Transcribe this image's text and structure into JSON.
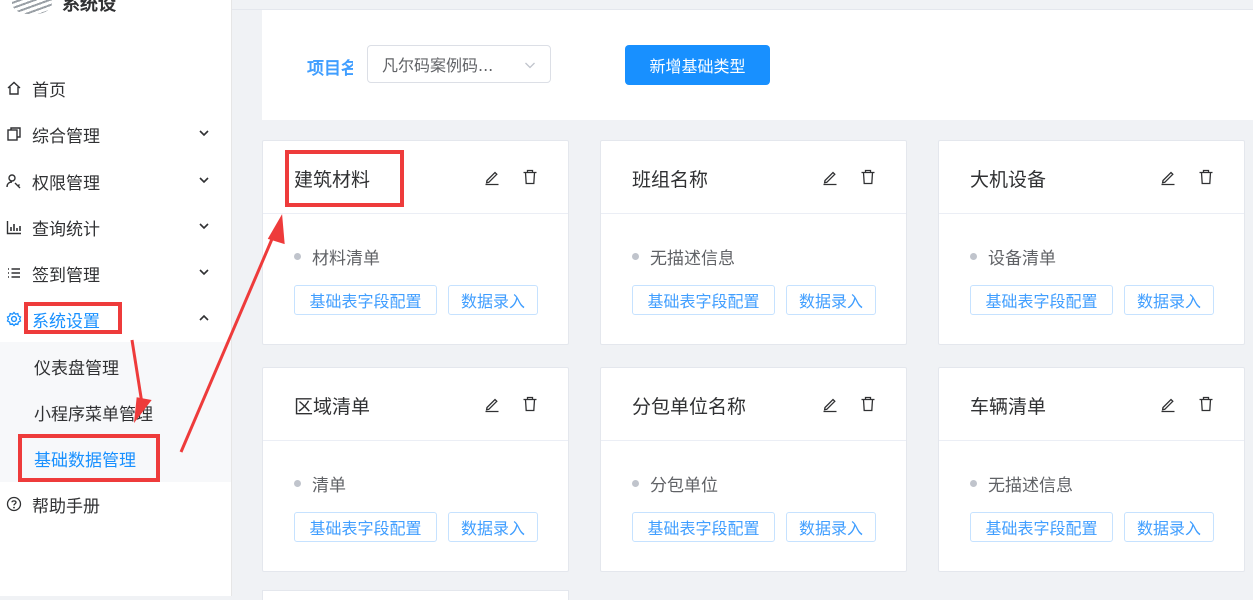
{
  "sidebar": {
    "logo_text": "系统设",
    "items": [
      {
        "label": "首页",
        "icon": "home-icon"
      },
      {
        "label": "综合管理",
        "icon": "copy-icon"
      },
      {
        "label": "权限管理",
        "icon": "user-key-icon"
      },
      {
        "label": "查询统计",
        "icon": "bar-chart-icon"
      },
      {
        "label": "签到管理",
        "icon": "list-icon"
      },
      {
        "label": "系统设置",
        "icon": "gear-icon"
      },
      {
        "label": "帮助手册",
        "icon": "question-circle-icon"
      }
    ],
    "submenu": [
      {
        "label": "仪表盘管理"
      },
      {
        "label": "小程序菜单管理"
      },
      {
        "label": "基础数据管理"
      }
    ]
  },
  "filter": {
    "project_label": "项目名",
    "project_value": "凡尔码案例码...",
    "add_button": "新增基础类型"
  },
  "cards": [
    {
      "title": "建筑材料",
      "desc": "材料清单",
      "config": "基础表字段配置",
      "entry": "数据录入"
    },
    {
      "title": "班组名称",
      "desc": "无描述信息",
      "config": "基础表字段配置",
      "entry": "数据录入"
    },
    {
      "title": "大机设备",
      "desc": "设备清单",
      "config": "基础表字段配置",
      "entry": "数据录入"
    },
    {
      "title": "区域清单",
      "desc": "清单",
      "config": "基础表字段配置",
      "entry": "数据录入"
    },
    {
      "title": "分包单位名称",
      "desc": "分包单位",
      "config": "基础表字段配置",
      "entry": "数据录入"
    },
    {
      "title": "车辆清单",
      "desc": "无描述信息",
      "config": "基础表字段配置",
      "entry": "数据录入"
    }
  ],
  "colors": {
    "accent": "#1890ff",
    "annotation": "#ee3b3b"
  }
}
